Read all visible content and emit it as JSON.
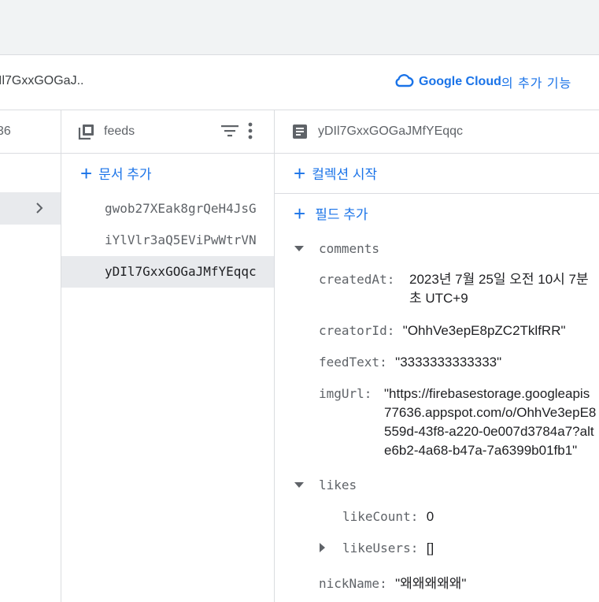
{
  "header": {
    "path_text": "Il7GxxGOGaJ..",
    "google_cloud": {
      "brand": "Google Cloud",
      "rest": "의 추가 기능"
    }
  },
  "left_column": {
    "header_text": "36"
  },
  "mid_column": {
    "title": "feeds",
    "add_document": "문서 추가",
    "documents": [
      "gwob27XEak8grQeH4JsG",
      "iYlVlr3aQ5EViPwWtrVN",
      "yDIl7GxxGOGaJMfYEqqc"
    ]
  },
  "right_column": {
    "title": "yDIl7GxxGOGaJMfYEqqc",
    "start_collection": "컬렉션 시작",
    "add_field": "필드 추가",
    "fields": {
      "comments": {
        "name": "comments"
      },
      "createdAt": {
        "name": "createdAt:",
        "line1": "2023년 7월 25일 오전 10시 7분",
        "line2": "초 UTC+9"
      },
      "creatorId": {
        "name": "creatorId:",
        "value": "\"OhhVe3epE8pZC2TklfRR\""
      },
      "feedText": {
        "name": "feedText:",
        "value": "\"3333333333333\""
      },
      "imgUrl": {
        "name": "imgUrl:",
        "line1": "\"https://firebasestorage.googleapis",
        "line2": "77636.appspot.com/o/OhhVe3epE8",
        "line3": "559d-43f8-a220-0e007d3784a7?alt",
        "line4": "e6b2-4a68-b47a-7a6399b01fb1\""
      },
      "likes": {
        "name": "likes"
      },
      "likeCount": {
        "name": "likeCount:",
        "value": "0"
      },
      "likeUsers": {
        "name": "likeUsers:",
        "value": "[]"
      },
      "nickName": {
        "name": "nickName:",
        "value": "\"왜왜왜왜왜\""
      }
    }
  }
}
